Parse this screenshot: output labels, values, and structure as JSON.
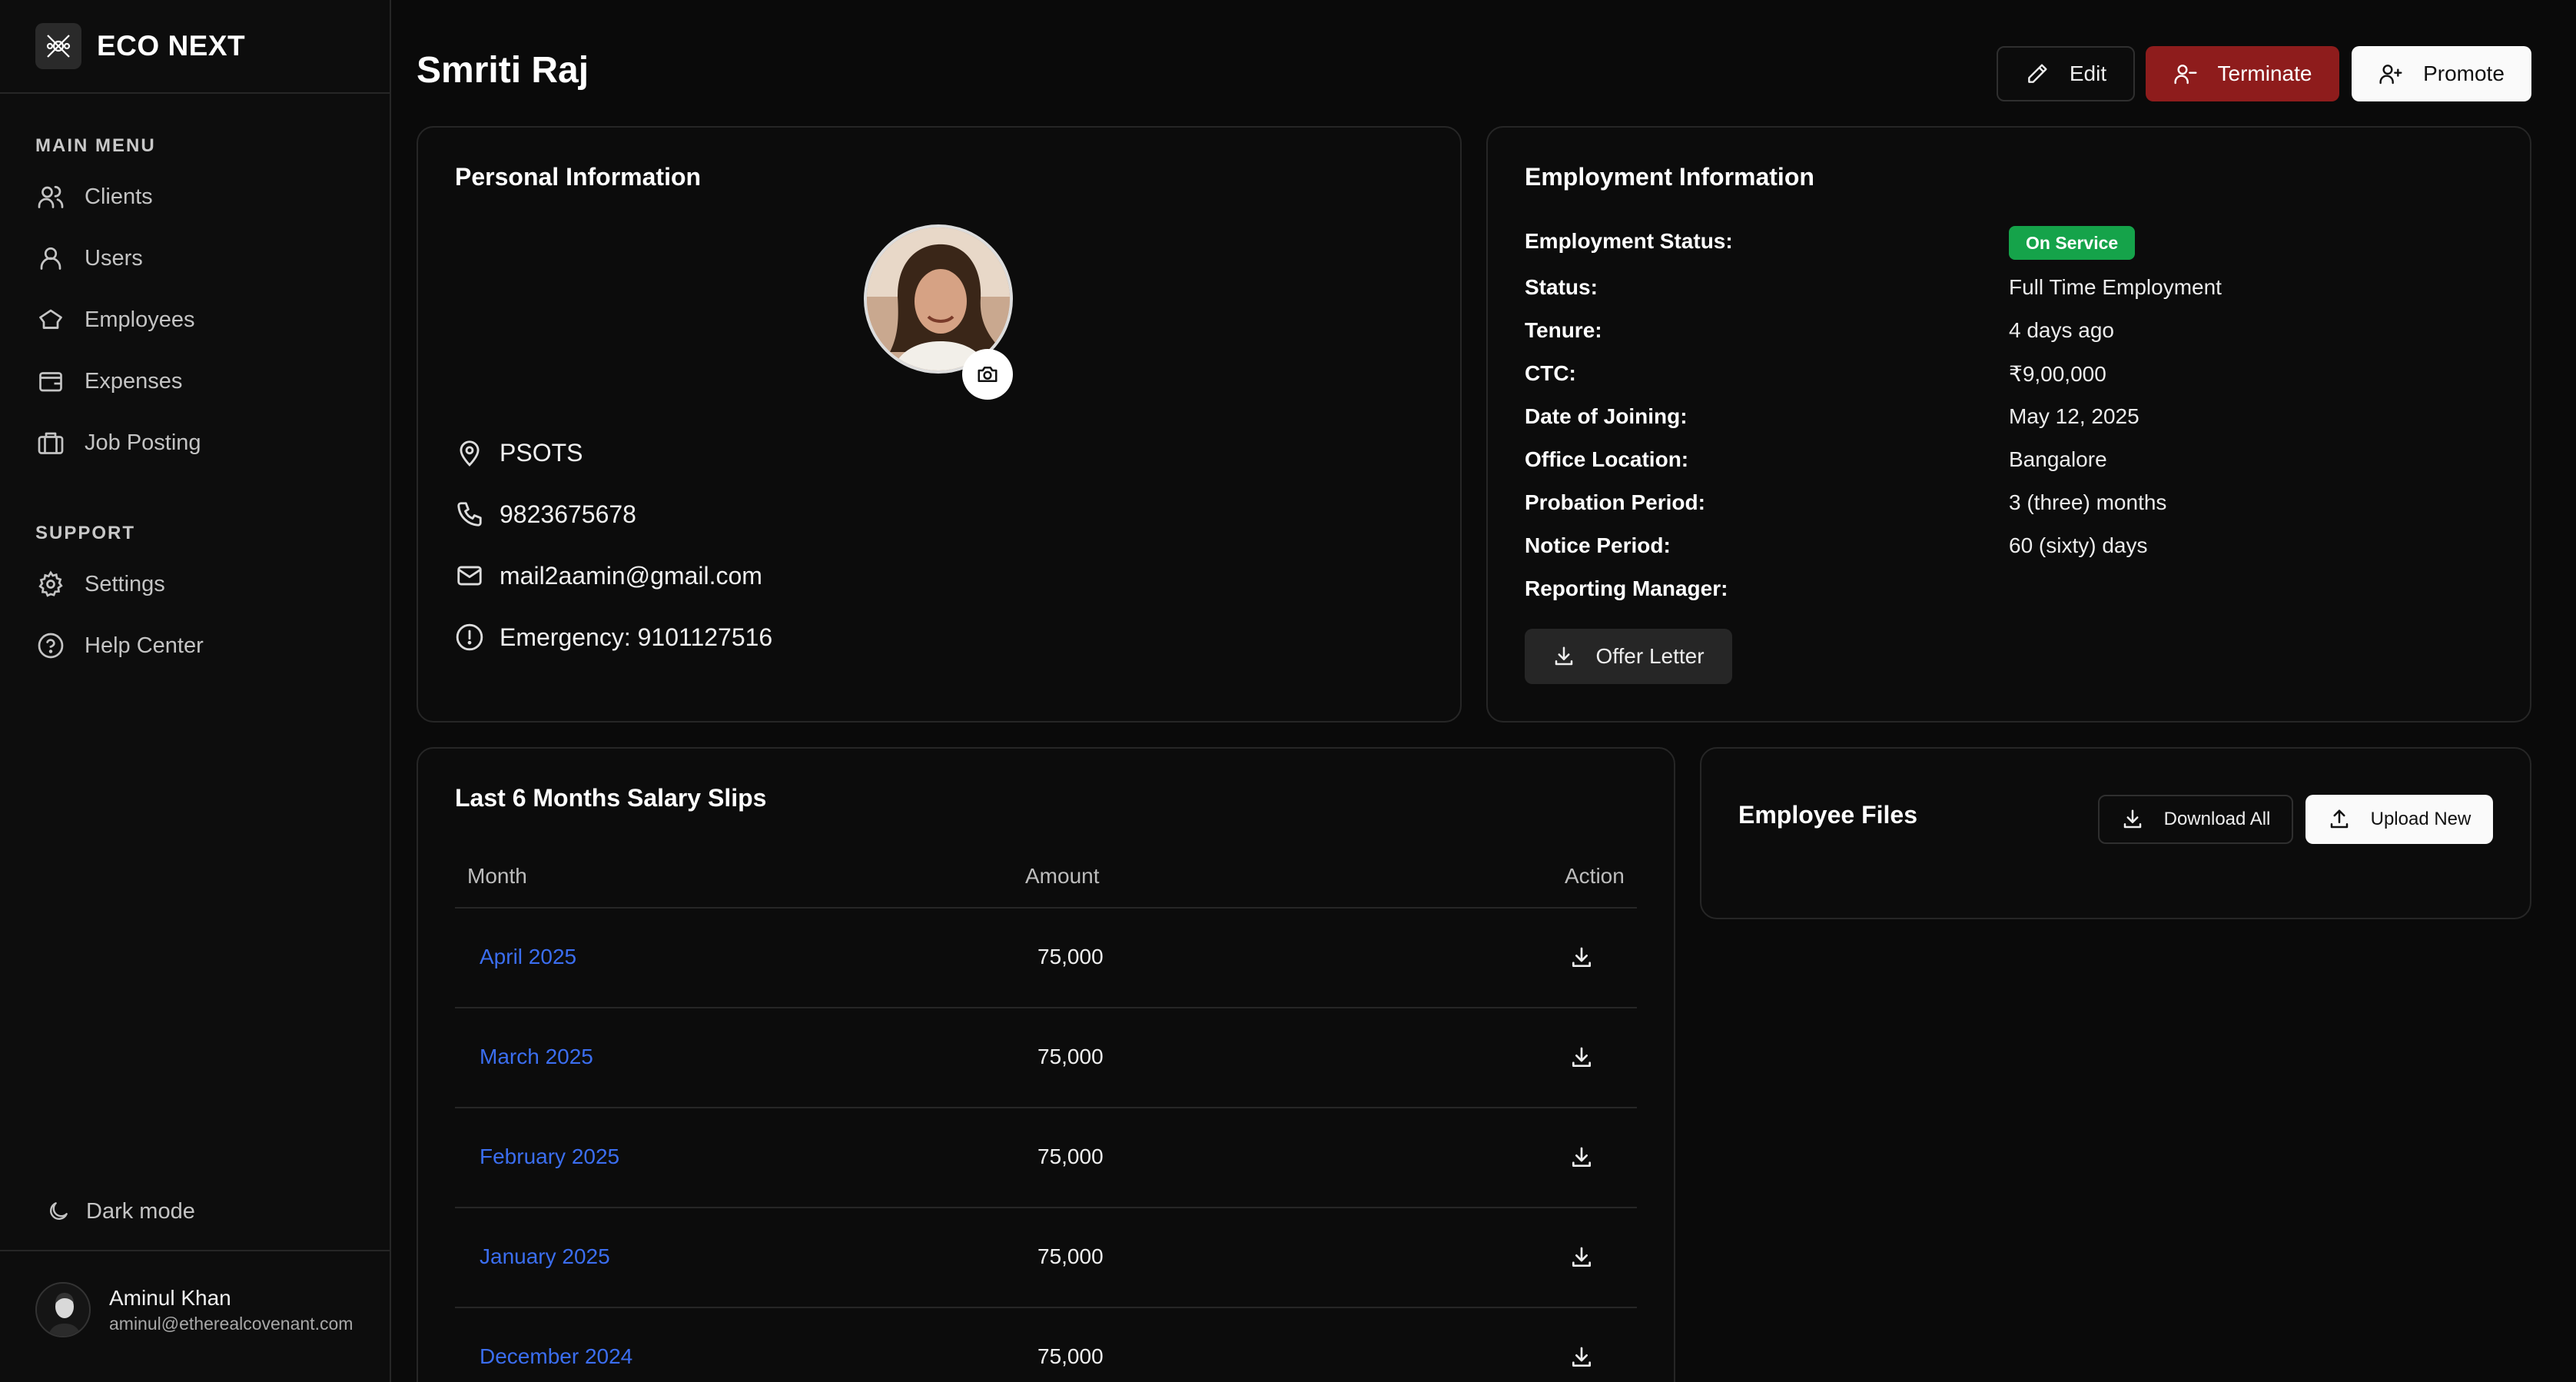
{
  "brand": {
    "name": "ECO NEXT",
    "logo_icon": "eco-next-logo-icon"
  },
  "sidebar": {
    "main_menu_title": "MAIN MENU",
    "main_items": [
      {
        "label": "Clients",
        "icon": "users-group-icon"
      },
      {
        "label": "Users",
        "icon": "user-icon"
      },
      {
        "label": "Employees",
        "icon": "chef-hat-icon"
      },
      {
        "label": "Expenses",
        "icon": "wallet-icon"
      },
      {
        "label": "Job Posting",
        "icon": "briefcase-icon"
      }
    ],
    "support_title": "SUPPORT",
    "support_items": [
      {
        "label": "Settings",
        "icon": "gear-icon"
      },
      {
        "label": "Help Center",
        "icon": "help-circle-icon"
      }
    ],
    "dark_mode_label": "Dark mode"
  },
  "current_user": {
    "name": "Aminul Khan",
    "email": "aminul@etherealcovenant.com"
  },
  "page": {
    "title": "Smriti Raj",
    "actions": {
      "edit": "Edit",
      "terminate": "Terminate",
      "promote": "Promote"
    }
  },
  "personal": {
    "title": "Personal Information",
    "location": "PSOTS",
    "phone": "9823675678",
    "email": "mail2aamin@gmail.com",
    "emergency": "Emergency: 9101127516"
  },
  "employment": {
    "title": "Employment Information",
    "status_badge": "On Service",
    "fields": [
      {
        "label": "Employment Status:",
        "value": ""
      },
      {
        "label": "Status:",
        "value": "Full Time Employment"
      },
      {
        "label": "Tenure:",
        "value": "4 days ago"
      },
      {
        "label": "CTC:",
        "value": "₹9,00,000"
      },
      {
        "label": "Date of Joining:",
        "value": "May 12, 2025"
      },
      {
        "label": "Office Location:",
        "value": "Bangalore"
      },
      {
        "label": "Probation Period:",
        "value": "3 (three) months"
      },
      {
        "label": "Notice Period:",
        "value": "60 (sixty) days"
      },
      {
        "label": "Reporting Manager:",
        "value": ""
      }
    ],
    "offer_letter_label": "Offer Letter"
  },
  "salary": {
    "title": "Last 6 Months Salary Slips",
    "columns": [
      "Month",
      "Amount",
      "Action"
    ],
    "rows": [
      {
        "month": "April 2025",
        "amount": "75,000"
      },
      {
        "month": "March 2025",
        "amount": "75,000"
      },
      {
        "month": "February 2025",
        "amount": "75,000"
      },
      {
        "month": "January 2025",
        "amount": "75,000"
      },
      {
        "month": "December 2024",
        "amount": "75,000"
      }
    ]
  },
  "files": {
    "title": "Employee Files",
    "download_all": "Download All",
    "upload_new": "Upload New"
  },
  "colors": {
    "background": "#0a0a0a",
    "terminate": "#8e1c1c",
    "badge_green": "#15a34a",
    "link_blue": "#3b6ef0"
  }
}
